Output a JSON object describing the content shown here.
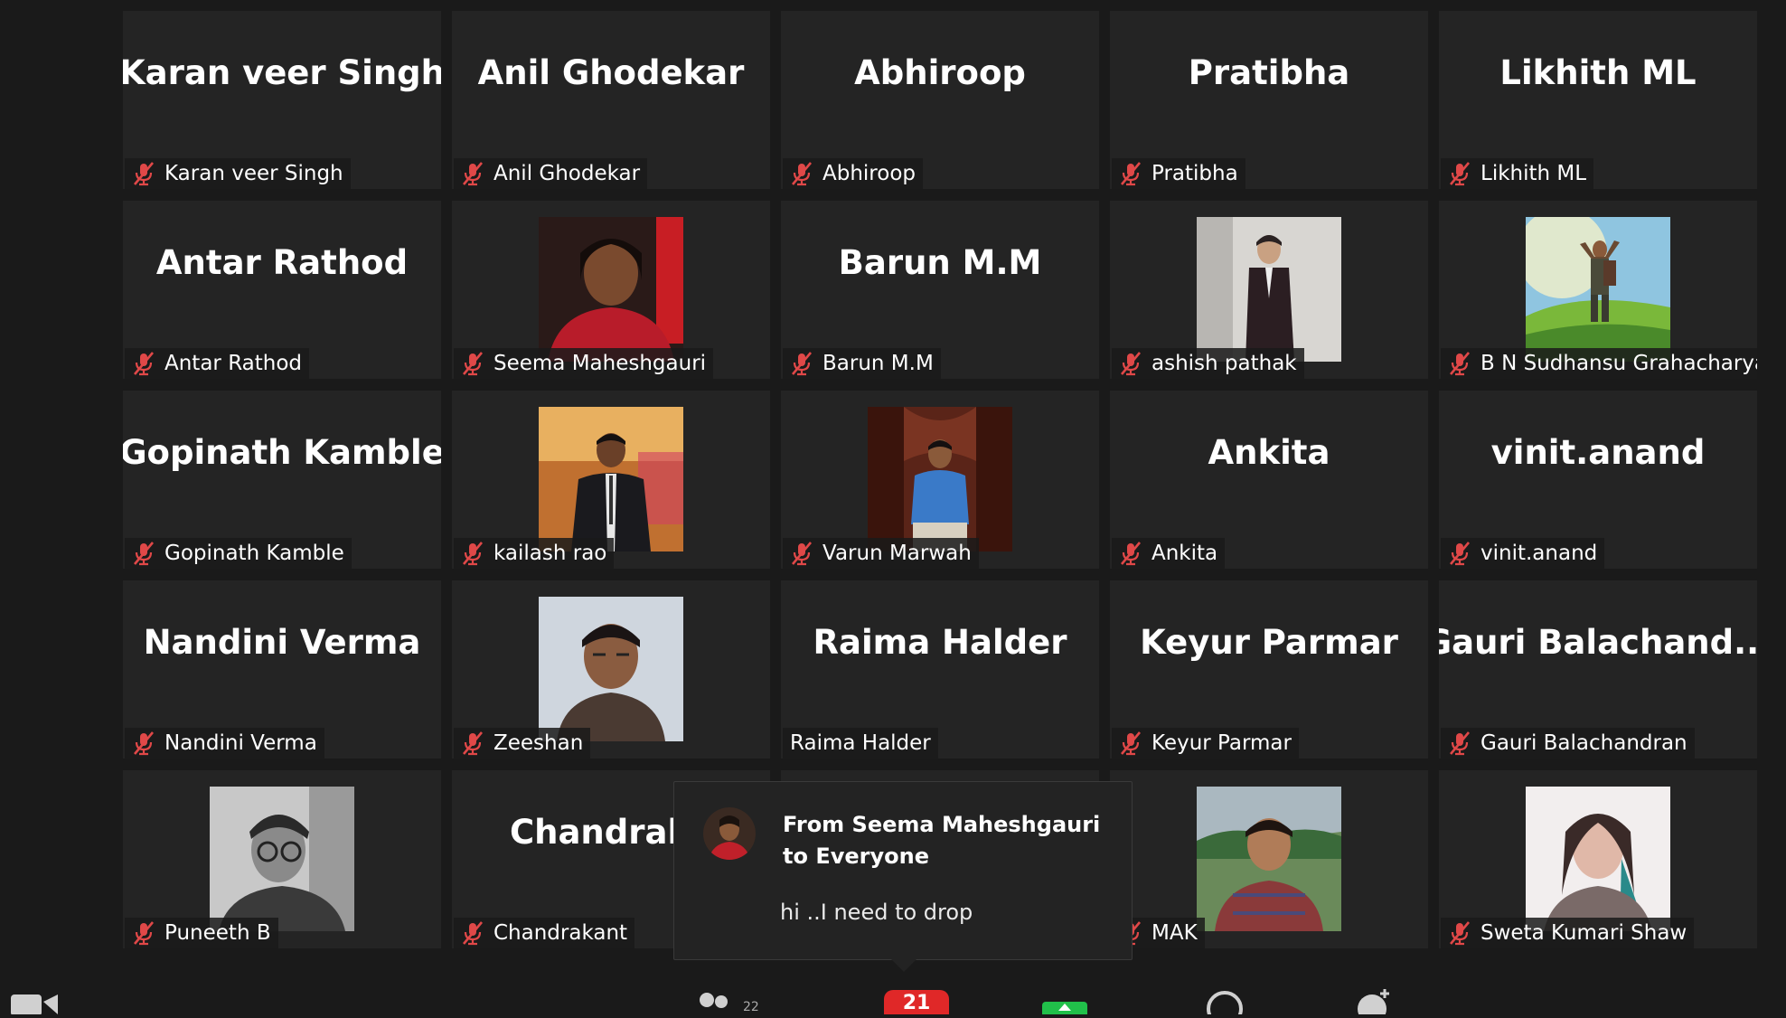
{
  "participants": [
    {
      "display": "Karan veer Singh",
      "label": "Karan veer Singh",
      "muted": true
    },
    {
      "display": "Anil Ghodekar",
      "label": "Anil Ghodekar",
      "muted": true
    },
    {
      "display": "Abhiroop",
      "label": "Abhiroop",
      "muted": true
    },
    {
      "display": "Pratibha",
      "label": "Pratibha",
      "muted": true
    },
    {
      "display": "Likhith ML",
      "label": "Likhith ML",
      "muted": true
    },
    {
      "display": "Antar Rathod",
      "label": "Antar Rathod",
      "muted": true
    },
    {
      "display": "",
      "label": "Seema Maheshgauri",
      "muted": true,
      "photo": "woman-red"
    },
    {
      "display": "Barun M.M",
      "label": "Barun M.M",
      "muted": true
    },
    {
      "display": "",
      "label": "ashish pathak",
      "muted": true,
      "photo": "man-suit-light"
    },
    {
      "display": "",
      "label": "B N Sudhansu Grahacharya",
      "muted": true,
      "photo": "hiker-landscape"
    },
    {
      "display": "Gopinath Kamble",
      "label": "Gopinath Kamble",
      "muted": true
    },
    {
      "display": "",
      "label": "kailash rao",
      "muted": true,
      "photo": "man-suit-warm"
    },
    {
      "display": "",
      "label": "Varun Marwah",
      "muted": true,
      "photo": "man-blue-shirt"
    },
    {
      "display": "Ankita",
      "label": "Ankita",
      "muted": true
    },
    {
      "display": "vinit.anand",
      "label": "vinit.anand",
      "muted": true
    },
    {
      "display": "Nandini Verma",
      "label": "Nandini Verma",
      "muted": true
    },
    {
      "display": "",
      "label": "Zeeshan",
      "muted": true,
      "photo": "man-portrait"
    },
    {
      "display": "Raima Halder",
      "label": "Raima Halder",
      "muted": false
    },
    {
      "display": "Keyur Parmar",
      "label": "Keyur Parmar",
      "muted": true
    },
    {
      "display": "Gauri  Balachand...",
      "label": "Gauri Balachandran",
      "muted": true
    },
    {
      "display": "",
      "label": "Puneeth B",
      "muted": true,
      "photo": "man-bw"
    },
    {
      "display": "Chandraka",
      "label": "Chandrakant",
      "muted": true
    },
    {
      "display": "",
      "label": "",
      "muted": false
    },
    {
      "display": "",
      "label": "MAK",
      "muted": true,
      "photo": "man-outdoor"
    },
    {
      "display": "",
      "label": "Sweta Kumari Shaw",
      "muted": true,
      "photo": "woman-light"
    }
  ],
  "chat": {
    "from": "From Seema Maheshgauri to Everyone",
    "message": "hi ..I need to drop"
  },
  "toolbar": {
    "participants_count": "22",
    "chat_badge": "21"
  },
  "icons": {
    "muted": "mic-muted-icon",
    "video": "video-icon",
    "participants": "participants-icon",
    "chat": "chat-icon",
    "share": "share-screen-icon",
    "record": "record-icon",
    "reactions": "reactions-icon"
  },
  "colors": {
    "background": "#1a1a1a",
    "tile": "#242424",
    "muted_icon": "#e04848",
    "share_green": "#21c04a",
    "badge": "#e02828"
  }
}
